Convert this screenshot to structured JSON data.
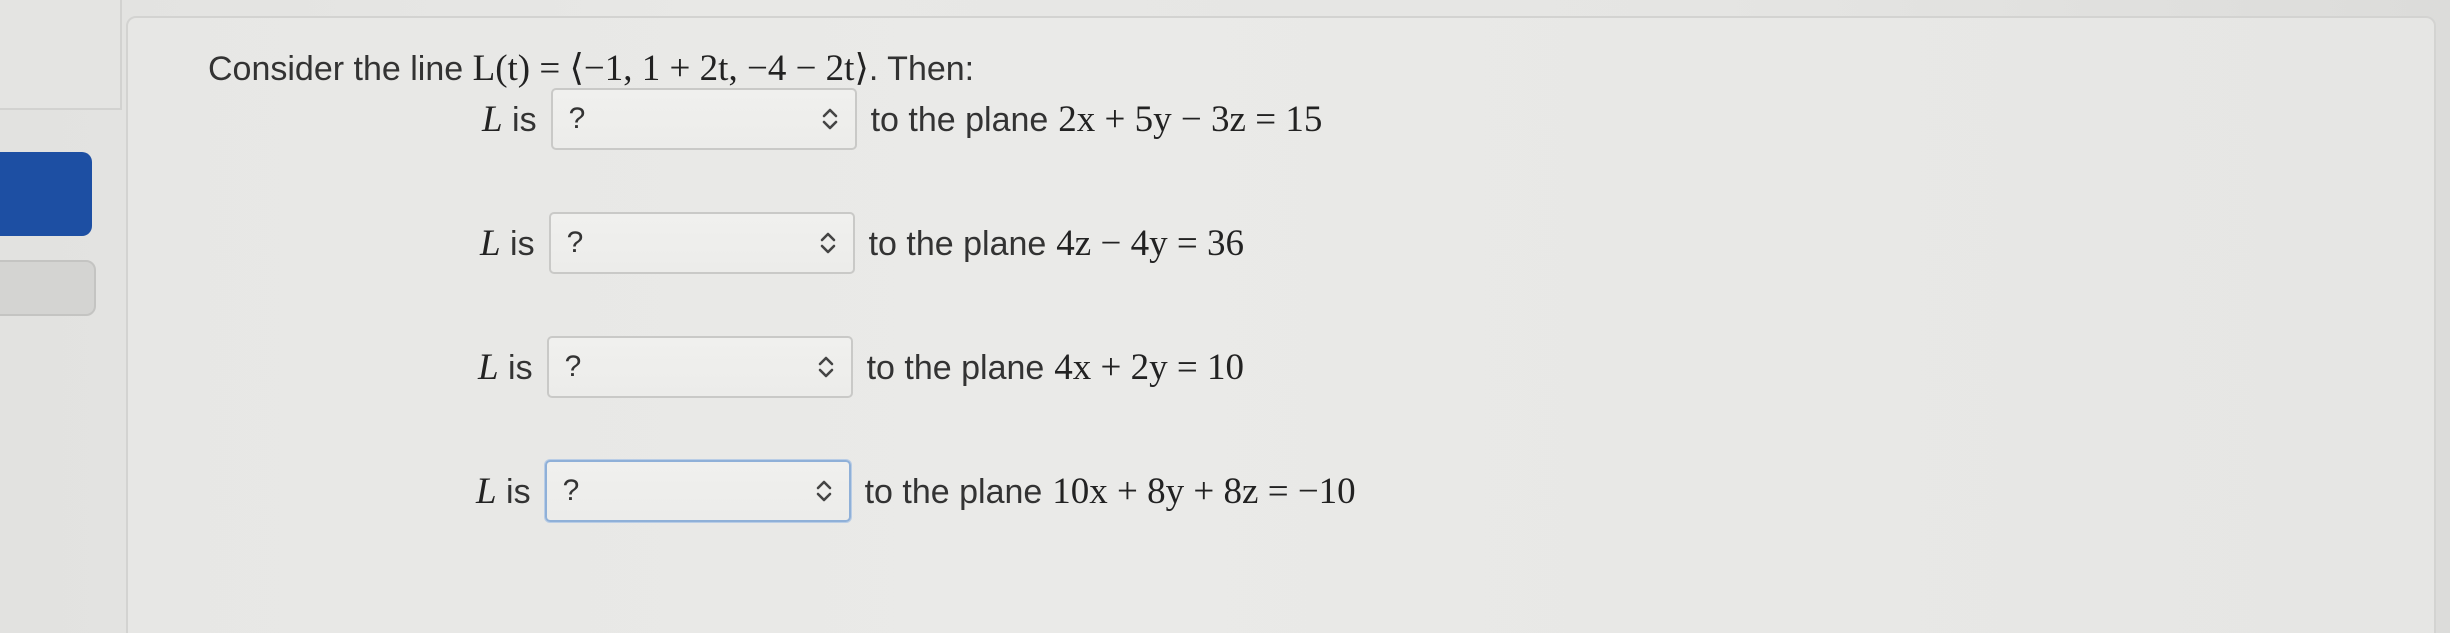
{
  "question": {
    "prefix": "Consider the line",
    "expression": "L(t) = ⟨−1, 1 + 2t, −4 − 2t⟩",
    "suffix": ". Then:"
  },
  "rows": [
    {
      "lhs_var": "L",
      "lhs_text": "is",
      "selected": "?",
      "rhs_text": "to the plane",
      "plane": "2x + 5y − 3z = 15"
    },
    {
      "lhs_var": "L",
      "lhs_text": "is",
      "selected": "?",
      "rhs_text": "to the plane",
      "plane": "4z − 4y = 36"
    },
    {
      "lhs_var": "L",
      "lhs_text": "is",
      "selected": "?",
      "rhs_text": "to the plane",
      "plane": "4x + 2y = 10"
    },
    {
      "lhs_var": "L",
      "lhs_text": "is",
      "selected": "?",
      "rhs_text": "to the plane",
      "plane": "10x + 8y + 8z = −10"
    }
  ],
  "colors": {
    "accent_blue": "#1d4fa3",
    "text": "#333333",
    "focus_border": "#8fb0d8"
  },
  "icons": {
    "select_chevron": "chevron-up-down-icon"
  }
}
